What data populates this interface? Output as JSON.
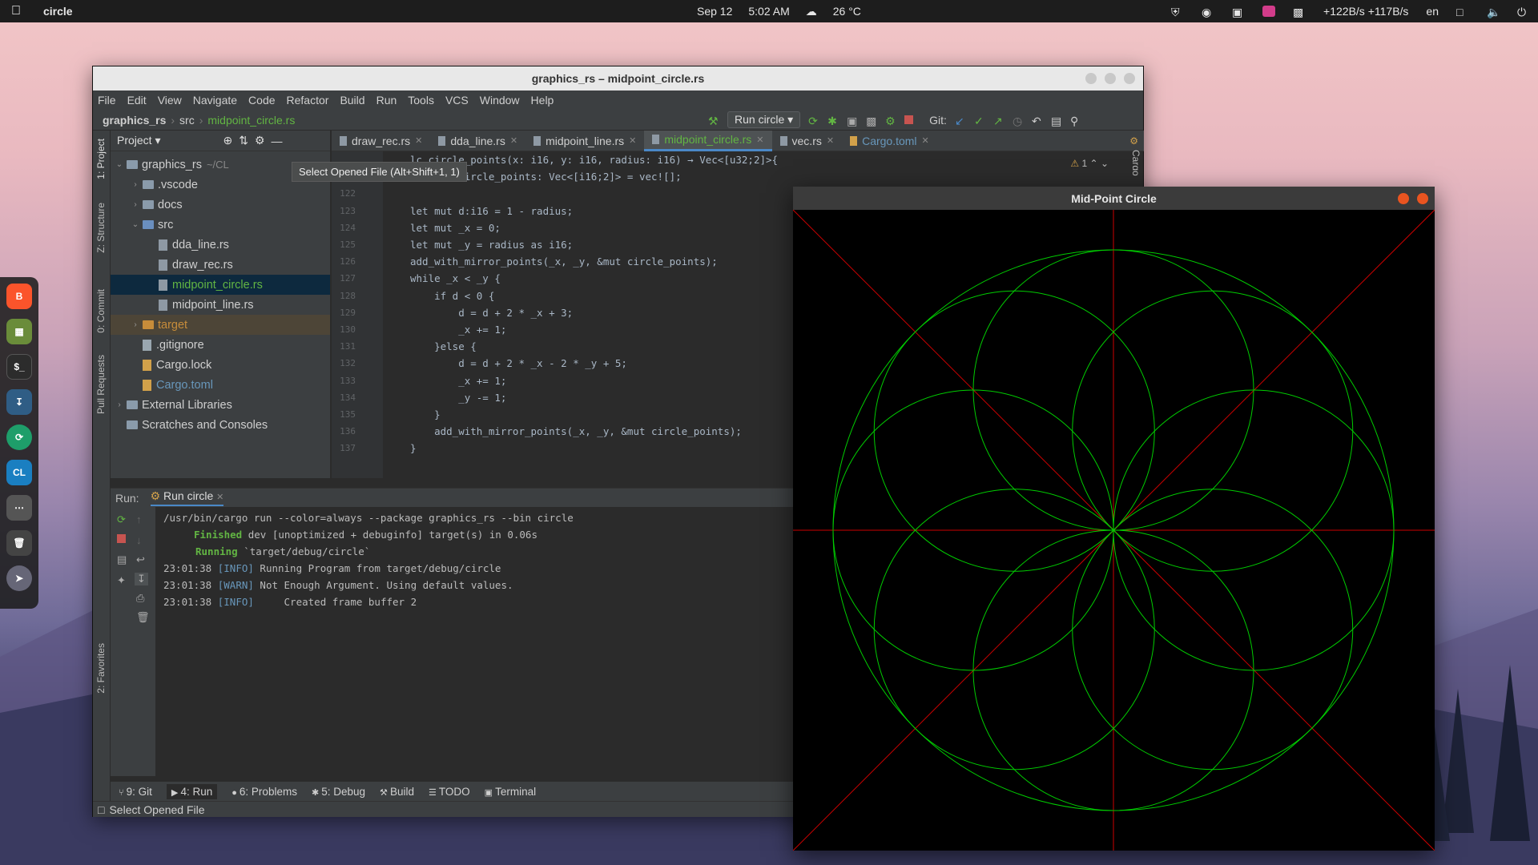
{
  "topbar": {
    "app_name": "circle",
    "date": "Sep 12",
    "time": "5:02 AM",
    "weather": "26 °C",
    "network": "+122B/s +117B/s",
    "lang": "en"
  },
  "ide": {
    "title": "graphics_rs – midpoint_circle.rs",
    "menu": [
      "File",
      "Edit",
      "View",
      "Navigate",
      "Code",
      "Refactor",
      "Build",
      "Run",
      "Tools",
      "VCS",
      "Window",
      "Help"
    ],
    "breadcrumb": {
      "project": "graphics_rs",
      "dir": "src",
      "file": "midpoint_circle.rs"
    },
    "run_config": "Run circle",
    "git_label": "Git:",
    "project_panel": {
      "title": "Project",
      "tooltip": "Select Opened File (Alt+Shift+1, 1)",
      "tree": [
        {
          "label": "graphics_rs",
          "suffix": "~/CL",
          "indent": 0,
          "kind": "folder",
          "open": true
        },
        {
          "label": ".vscode",
          "indent": 1,
          "kind": "folder",
          "open": false
        },
        {
          "label": "docs",
          "indent": 1,
          "kind": "folder",
          "open": false
        },
        {
          "label": "src",
          "indent": 1,
          "kind": "src",
          "open": true
        },
        {
          "label": "dda_line.rs",
          "indent": 2,
          "kind": "rs"
        },
        {
          "label": "draw_rec.rs",
          "indent": 2,
          "kind": "rs"
        },
        {
          "label": "midpoint_circle.rs",
          "indent": 2,
          "kind": "rs",
          "selected": true
        },
        {
          "label": "midpoint_line.rs",
          "indent": 2,
          "kind": "rs"
        },
        {
          "label": "target",
          "indent": 1,
          "kind": "target",
          "open": false
        },
        {
          "label": ".gitignore",
          "indent": 1,
          "kind": "file"
        },
        {
          "label": "Cargo.lock",
          "indent": 1,
          "kind": "lock"
        },
        {
          "label": "Cargo.toml",
          "indent": 1,
          "kind": "toml"
        },
        {
          "label": "External Libraries",
          "indent": 0,
          "kind": "lib",
          "open": false
        },
        {
          "label": "Scratches and Consoles",
          "indent": 0,
          "kind": "scratch"
        }
      ]
    },
    "side_tabs": [
      "1: Project",
      "Z: Structure",
      "0: Commit",
      "Pull Requests",
      "2: Favorites"
    ],
    "right_tab": "Cargo",
    "editor_tabs": [
      {
        "label": "draw_rec.rs"
      },
      {
        "label": "dda_line.rs"
      },
      {
        "label": "midpoint_line.rs"
      },
      {
        "label": "midpoint_circle.rs",
        "active": true
      },
      {
        "label": "vec.rs"
      },
      {
        "label": "Cargo.toml"
      }
    ],
    "warning_count": "1",
    "code_lines": [
      {
        "n": "",
        "t": "lc_circle_points(x: i16, y: i16, radius: i16) → Vec<[u32;2]>{"
      },
      {
        "n": "121",
        "t": "let mut circle_points: Vec<[i16;2]> = vec![];"
      },
      {
        "n": "122",
        "t": ""
      },
      {
        "n": "123",
        "t": "let mut d:i16 = 1 - radius;"
      },
      {
        "n": "124",
        "t": "let mut _x = 0;"
      },
      {
        "n": "125",
        "t": "let mut _y = radius as i16;"
      },
      {
        "n": "126",
        "t": "add_with_mirror_points(_x, _y, &mut circle_points);"
      },
      {
        "n": "127",
        "t": "while _x < _y {"
      },
      {
        "n": "128",
        "t": "    if d < 0 {"
      },
      {
        "n": "129",
        "t": "        d = d + 2 * _x + 3;"
      },
      {
        "n": "130",
        "t": "        _x += 1;"
      },
      {
        "n": "131",
        "t": "    }else {"
      },
      {
        "n": "132",
        "t": "        d = d + 2 * _x - 2 * _y + 5;"
      },
      {
        "n": "133",
        "t": "        _x += 1;"
      },
      {
        "n": "134",
        "t": "        _y -= 1;"
      },
      {
        "n": "135",
        "t": "    }"
      },
      {
        "n": "136",
        "t": "    add_with_mirror_points(_x, _y, &mut circle_points);"
      },
      {
        "n": "137",
        "t": "}"
      }
    ],
    "run_panel": {
      "label": "Run:",
      "tab": "Run circle",
      "lines": [
        {
          "time": "",
          "level": "",
          "text": "/usr/bin/cargo run --color=always --package graphics_rs --bin circle"
        },
        {
          "time": "",
          "level": "Finished",
          "text": " dev [unoptimized + debuginfo] target(s) in 0.06s"
        },
        {
          "time": "",
          "level": "Running",
          "text": " `target/debug/circle`"
        },
        {
          "time": "23:01:38",
          "level": "[INFO]",
          "text": " Running Program from target/debug/circle"
        },
        {
          "time": "23:01:38",
          "level": "[WARN]",
          "text": " Not Enough Argument. Using default values."
        },
        {
          "time": "23:01:38",
          "level": "[INFO]",
          "text": "     Created frame buffer 2"
        }
      ]
    },
    "bottom_tabs": [
      "9: Git",
      "4: Run",
      "6: Problems",
      "5: Debug",
      "Build",
      "TODO",
      "Terminal"
    ],
    "status": "Select Opened File"
  },
  "circle_window": {
    "title": "Mid-Point Circle",
    "colors": {
      "circles": "#00cc00",
      "axes": "#cc0000",
      "bg": "#000000"
    },
    "petal_count": 8
  }
}
